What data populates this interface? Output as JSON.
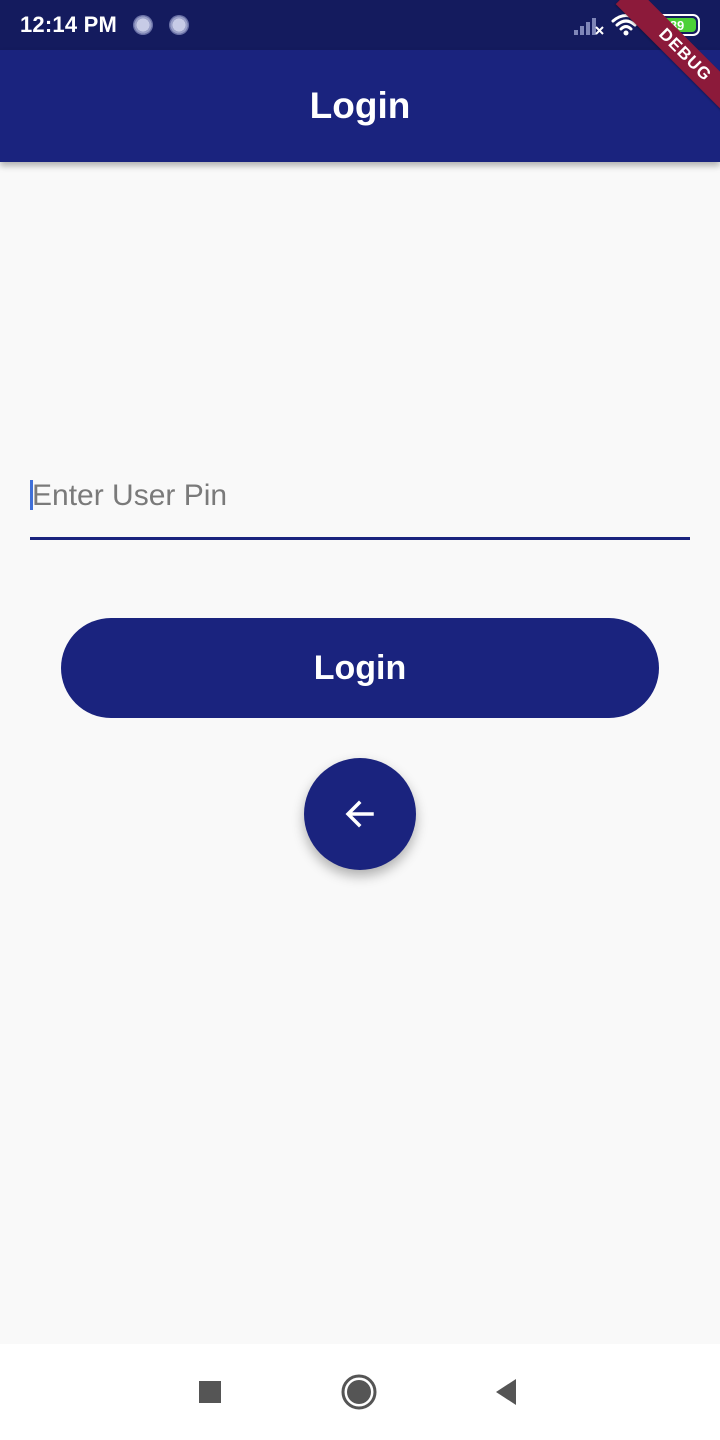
{
  "status_bar": {
    "time": "12:14 PM",
    "battery_level": "89",
    "icons": [
      "notification-dot-icon",
      "notification-dot-icon",
      "signal-icon",
      "wifi-icon",
      "battery-icon"
    ]
  },
  "app_bar": {
    "title": "Login"
  },
  "debug_banner": {
    "label": "DEBUG"
  },
  "form": {
    "pin_placeholder": "Enter User Pin",
    "pin_value": "",
    "login_button_label": "Login",
    "back_button_icon": "arrow-back-icon"
  },
  "nav_bar": {
    "icons": [
      "recent-apps-icon",
      "home-icon",
      "back-icon"
    ]
  },
  "colors": {
    "primary": "#1a237e",
    "status_bar": "#141b5e",
    "background": "#f9f9f9",
    "debug_banner": "#8c1a3a",
    "battery": "#4cd137"
  }
}
